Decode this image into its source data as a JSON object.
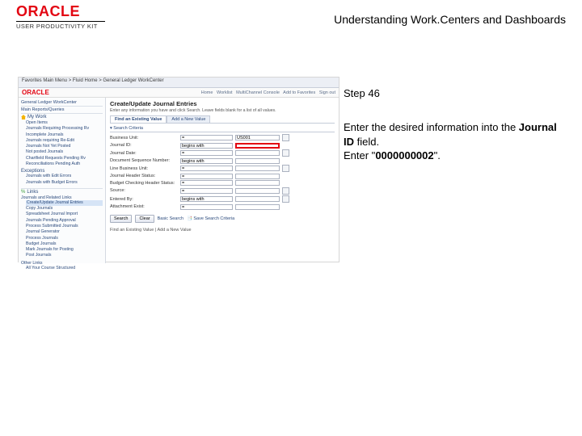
{
  "header": {
    "logo_text": "ORACLE",
    "logo_sub": "USER PRODUCTIVITY KIT",
    "doc_title": "Understanding Work.Centers and Dashboards"
  },
  "step": {
    "label": "Step 46",
    "line1_pre": "Enter the desired information into the ",
    "line1_bold": "Journal ID",
    "line1_post": " field.",
    "line2_pre": "Enter \"",
    "line2_bold": "0000000002",
    "line2_post": "\"."
  },
  "shot": {
    "topbar": "Favorites      Main Menu   >   Fluid Home   >   General Ledger WorkCenter",
    "nav_items": [
      "Home",
      "Worklist",
      "MultiChannel Console",
      "Add to Favorites",
      "Sign out"
    ],
    "workcenter_title": "General Ledger WorkCenter",
    "main_crumb": "Main   Reports/Queries",
    "my_work": "My Work",
    "sidebar_items": [
      "Open Items",
      "Journals Requiring Processing Rv",
      "Incomplete Journals",
      "Journals requiring Re-Edit",
      "Journals Not Yet Posted",
      "Not posted Journals",
      "Chartfield Requests Pending Rv",
      "Reconciliations Pending Auth"
    ],
    "exceptions": "Exceptions",
    "exceptions_items": [
      "Journals with Edit Errors",
      "Journals with Budget Errors"
    ],
    "links_hdr": "Links",
    "links_sect": "Journals and Related Links",
    "selected_link": "Create/Update Journal Entries",
    "links_items": [
      "Copy Journals",
      "Spreadsheet Journal Import",
      "Journals Pending Approval",
      "Process Submitted Journals",
      "Journal Generator",
      "Process Journals",
      "Budget Journals",
      "Mark Journals for Posting",
      "Post Journals"
    ],
    "other_links": "Other Links",
    "other_item": "All Your Course Structured",
    "page_title": "Create/Update Journal Entries",
    "page_sub": "Enter any information you have and click Search. Leave fields blank for a list of all values.",
    "tab_find": "Find an Existing Value",
    "tab_add": "Add a New Value",
    "search_hdr": "Search Criteria",
    "labels": {
      "bu": "Business Unit:",
      "jid": "Journal ID:",
      "jdate": "Journal Date:",
      "dr": "Document Sequence Number:",
      "lnbu": "Line Business Unit:",
      "jhs": "Journal Header Status:",
      "bcs": "Budget Checking Header Status:",
      "src": "Source:",
      "eb": "Entered By:",
      "ajs": "Attachment Exist:"
    },
    "ops": {
      "begins": "begins with",
      "eq": "="
    },
    "bu_val": "US001",
    "btn_search": "Search",
    "btn_clear": "Clear",
    "btn_basic": "Basic Search",
    "btn_save": "Save Search Criteria",
    "footer": "Find an Existing Value   |   Add a New Value"
  }
}
